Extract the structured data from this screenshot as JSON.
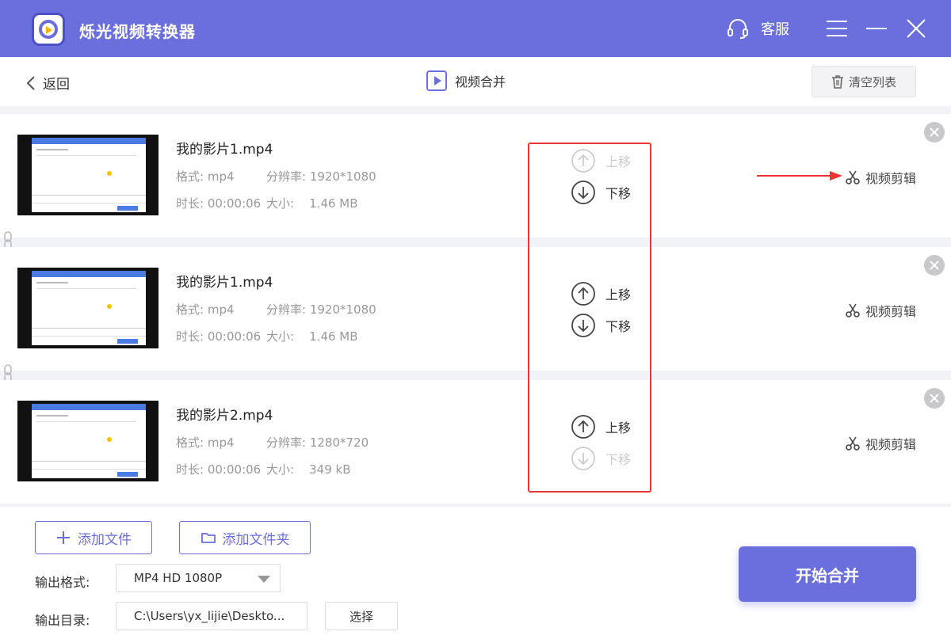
{
  "app": {
    "title": "烁光视频转换器",
    "support_label": "客服",
    "icons": {
      "logo": "app-logo-icon",
      "support": "headset-icon",
      "menu": "menu-icon",
      "minimize": "minimize-icon",
      "close": "close-icon"
    }
  },
  "nav": {
    "back_label": "返回",
    "title": "视频合并",
    "clear_label": "清空列表"
  },
  "videos": [
    {
      "name": "我的影片1.mp4",
      "format_label": "格式:",
      "format": "mp4",
      "resolution_label": "分辨率:",
      "resolution": "1920*1080",
      "duration_label": "时长:",
      "duration": "00:00:06",
      "size_label": "大小:",
      "size": "1.46 MB",
      "move_up": "上移",
      "move_down": "下移",
      "move_up_enabled": false,
      "move_down_enabled": true,
      "edit_label": "视频剪辑"
    },
    {
      "name": "我的影片1.mp4",
      "format_label": "格式:",
      "format": "mp4",
      "resolution_label": "分辨率:",
      "resolution": "1920*1080",
      "duration_label": "时长:",
      "duration": "00:00:06",
      "size_label": "大小:",
      "size": "1.46 MB",
      "move_up": "上移",
      "move_down": "下移",
      "move_up_enabled": true,
      "move_down_enabled": true,
      "edit_label": "视频剪辑"
    },
    {
      "name": "我的影片2.mp4",
      "format_label": "格式:",
      "format": "mp4",
      "resolution_label": "分辨率:",
      "resolution": "1280*720",
      "duration_label": "时长:",
      "duration": "00:00:06",
      "size_label": "大小:",
      "size": "349 kB",
      "move_up": "上移",
      "move_down": "下移",
      "move_up_enabled": true,
      "move_down_enabled": false,
      "edit_label": "视频剪辑"
    }
  ],
  "bottom": {
    "add_file": "添加文件",
    "add_folder": "添加文件夹",
    "output_format_label": "输出格式:",
    "output_format_value": "MP4 HD 1080P",
    "output_dir_label": "输出目录:",
    "output_dir_value": "C:\\Users\\yx_lijie\\Deskto...",
    "choose_label": "选择",
    "start_label": "开始合并"
  },
  "colors": {
    "accent": "#6b6fdd",
    "annotation": "#e33333",
    "disabled": "#cccccc"
  }
}
